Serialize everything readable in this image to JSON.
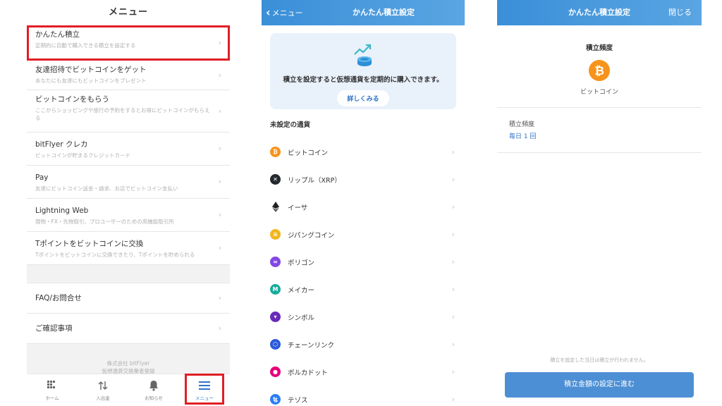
{
  "menu_screen": {
    "title": "メニュー",
    "items": [
      {
        "label": "かんたん積立",
        "desc": "定期的に自動で購入できる積立を設定する"
      },
      {
        "label": "友達招待でビットコインをゲット",
        "desc": "あなたにも友達にもビットコインをプレゼント"
      },
      {
        "label": "ビットコインをもらう",
        "desc": "ここからショッピングや旅行の予約をするとお得にビットコインがもらえる"
      },
      {
        "label": "bitFlyer クレカ",
        "desc": "ビットコインが貯まるクレジットカード"
      },
      {
        "label": "Pay",
        "desc": "友達にビットコイン送金・請求、お店でビットコイン支払い"
      },
      {
        "label": "Lightning Web",
        "desc": "現物・FX・先物取引、プロユーザーのための高機能取引所"
      },
      {
        "label": "Tポイントをビットコインに交換",
        "desc": "Tポイントをビットコインに交換できたり、Tポイントを貯められる"
      }
    ],
    "items2": [
      {
        "label": "FAQ/お問合せ"
      },
      {
        "label": "ご確認事項"
      }
    ],
    "footer_line1": "株式会社 bitFlyer",
    "footer_line2": "仮想通貨交換業者登録",
    "tabs": [
      {
        "label": "ホーム",
        "icon": "home-grid-icon"
      },
      {
        "label": "入出金",
        "icon": "transfer-arrows-icon"
      },
      {
        "label": "お知らせ",
        "icon": "bell-icon"
      },
      {
        "label": "メニュー",
        "icon": "hamburger-icon"
      }
    ],
    "highlight_color": "#e01e25"
  },
  "list_screen": {
    "back_label": "メニュー",
    "title": "かんたん積立設定",
    "promo_text": "積立を設定すると仮想通貨を定期的に購入できます。",
    "promo_button": "詳しくみる",
    "section_title": "未設定の通貨",
    "coins": [
      {
        "name": "ビットコイン",
        "icon": "bitcoin-icon",
        "color": "#f7931a",
        "glyph": "₿"
      },
      {
        "name": "リップル（XRP）",
        "icon": "xrp-icon",
        "color": "#23292f",
        "glyph": "✕"
      },
      {
        "name": "イーサ",
        "icon": "ethereum-icon",
        "color": "#ffffff",
        "glyph": "◆"
      },
      {
        "name": "ジパングコイン",
        "icon": "zipangcoin-icon",
        "color": "#f2b51c",
        "glyph": "≋"
      },
      {
        "name": "ポリゴン",
        "icon": "polygon-icon",
        "color": "#8247e5",
        "glyph": "∞"
      },
      {
        "name": "メイカー",
        "icon": "maker-icon",
        "color": "#1aab9b",
        "glyph": "M"
      },
      {
        "name": "シンボル",
        "icon": "symbol-icon",
        "color": "#6a2bb8",
        "glyph": "▾"
      },
      {
        "name": "チェーンリンク",
        "icon": "chainlink-icon",
        "color": "#2a5ada",
        "glyph": "⬡"
      },
      {
        "name": "ポルカドット",
        "icon": "polkadot-icon",
        "color": "#e6007a",
        "glyph": "●"
      },
      {
        "name": "テゾス",
        "icon": "tezos-icon",
        "color": "#2c7df7",
        "glyph": "ꜩ"
      }
    ]
  },
  "freq_screen": {
    "title": "かんたん積立設定",
    "close_label": "閉じる",
    "heading": "積立頻度",
    "coin_name": "ビットコイン",
    "coin_icon": "bitcoin-icon",
    "freq_label": "積立頻度",
    "freq_value": "毎日 1 回",
    "note": "積立を設定した当日は積立が行われません。",
    "cta_label": "積立金額の設定に進む"
  },
  "colors": {
    "header_blue": "#3a8fd8",
    "accent_blue": "#2f73c9",
    "button_blue": "#4d8fd4",
    "bitcoin_orange": "#f7931a"
  }
}
